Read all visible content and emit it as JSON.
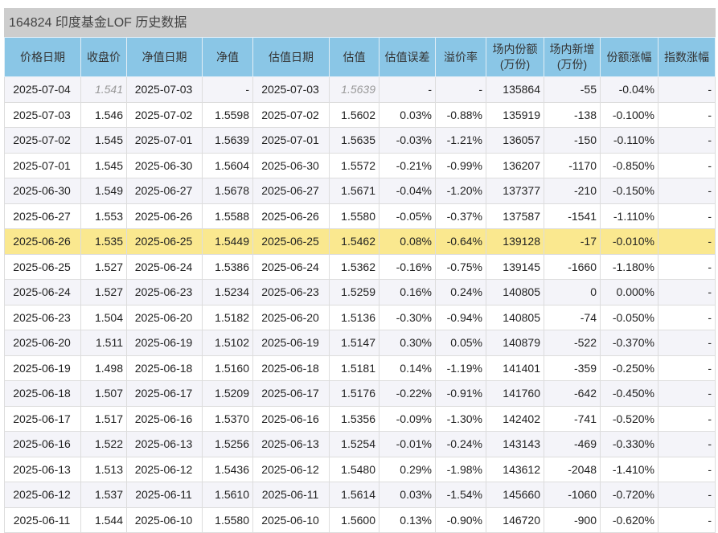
{
  "title": "164824 印度基金LOF 历史数据",
  "columns": [
    "价格日期",
    "收盘价",
    "净值日期",
    "净值",
    "估值日期",
    "估值",
    "估值误差",
    "溢价率",
    "场内份额\n(万份)",
    "场内新增\n(万份)",
    "份额涨幅",
    "指数涨幅"
  ],
  "highlight_color": "#fae88f",
  "highlight_row": 6,
  "estimated_row": 0,
  "rows": [
    [
      "2025-07-04",
      "1.541",
      "2025-07-03",
      "-",
      "2025-07-03",
      "1.5639",
      "-",
      "-",
      "135864",
      "-55",
      "-0.04%",
      "-"
    ],
    [
      "2025-07-03",
      "1.546",
      "2025-07-02",
      "1.5598",
      "2025-07-02",
      "1.5602",
      "0.03%",
      "-0.88%",
      "135919",
      "-138",
      "-0.100%",
      "-"
    ],
    [
      "2025-07-02",
      "1.545",
      "2025-07-01",
      "1.5639",
      "2025-07-01",
      "1.5635",
      "-0.03%",
      "-1.21%",
      "136057",
      "-150",
      "-0.110%",
      "-"
    ],
    [
      "2025-07-01",
      "1.545",
      "2025-06-30",
      "1.5604",
      "2025-06-30",
      "1.5572",
      "-0.21%",
      "-0.99%",
      "136207",
      "-1170",
      "-0.850%",
      "-"
    ],
    [
      "2025-06-30",
      "1.549",
      "2025-06-27",
      "1.5678",
      "2025-06-27",
      "1.5671",
      "-0.04%",
      "-1.20%",
      "137377",
      "-210",
      "-0.150%",
      "-"
    ],
    [
      "2025-06-27",
      "1.553",
      "2025-06-26",
      "1.5588",
      "2025-06-26",
      "1.5580",
      "-0.05%",
      "-0.37%",
      "137587",
      "-1541",
      "-1.110%",
      "-"
    ],
    [
      "2025-06-26",
      "1.535",
      "2025-06-25",
      "1.5449",
      "2025-06-25",
      "1.5462",
      "0.08%",
      "-0.64%",
      "139128",
      "-17",
      "-0.010%",
      "-"
    ],
    [
      "2025-06-25",
      "1.527",
      "2025-06-24",
      "1.5386",
      "2025-06-24",
      "1.5362",
      "-0.16%",
      "-0.75%",
      "139145",
      "-1660",
      "-1.180%",
      "-"
    ],
    [
      "2025-06-24",
      "1.527",
      "2025-06-23",
      "1.5234",
      "2025-06-23",
      "1.5259",
      "0.16%",
      "0.24%",
      "140805",
      "0",
      "0.000%",
      "-"
    ],
    [
      "2025-06-23",
      "1.504",
      "2025-06-20",
      "1.5182",
      "2025-06-20",
      "1.5136",
      "-0.30%",
      "-0.94%",
      "140805",
      "-74",
      "-0.050%",
      "-"
    ],
    [
      "2025-06-20",
      "1.511",
      "2025-06-19",
      "1.5102",
      "2025-06-19",
      "1.5147",
      "0.30%",
      "0.05%",
      "140879",
      "-522",
      "-0.370%",
      "-"
    ],
    [
      "2025-06-19",
      "1.498",
      "2025-06-18",
      "1.5160",
      "2025-06-18",
      "1.5181",
      "0.14%",
      "-1.19%",
      "141401",
      "-359",
      "-0.250%",
      "-"
    ],
    [
      "2025-06-18",
      "1.507",
      "2025-06-17",
      "1.5209",
      "2025-06-17",
      "1.5176",
      "-0.22%",
      "-0.91%",
      "141760",
      "-642",
      "-0.450%",
      "-"
    ],
    [
      "2025-06-17",
      "1.517",
      "2025-06-16",
      "1.5370",
      "2025-06-16",
      "1.5356",
      "-0.09%",
      "-1.30%",
      "142402",
      "-741",
      "-0.520%",
      "-"
    ],
    [
      "2025-06-16",
      "1.522",
      "2025-06-13",
      "1.5256",
      "2025-06-13",
      "1.5254",
      "-0.01%",
      "-0.24%",
      "143143",
      "-469",
      "-0.330%",
      "-"
    ],
    [
      "2025-06-13",
      "1.513",
      "2025-06-12",
      "1.5436",
      "2025-06-12",
      "1.5480",
      "0.29%",
      "-1.98%",
      "143612",
      "-2048",
      "-1.410%",
      "-"
    ],
    [
      "2025-06-12",
      "1.537",
      "2025-06-11",
      "1.5610",
      "2025-06-11",
      "1.5614",
      "0.03%",
      "-1.54%",
      "145660",
      "-1060",
      "-0.720%",
      "-"
    ],
    [
      "2025-06-11",
      "1.544",
      "2025-06-10",
      "1.5580",
      "2025-06-10",
      "1.5600",
      "0.13%",
      "-0.90%",
      "146720",
      "-900",
      "-0.620%",
      "-"
    ]
  ]
}
